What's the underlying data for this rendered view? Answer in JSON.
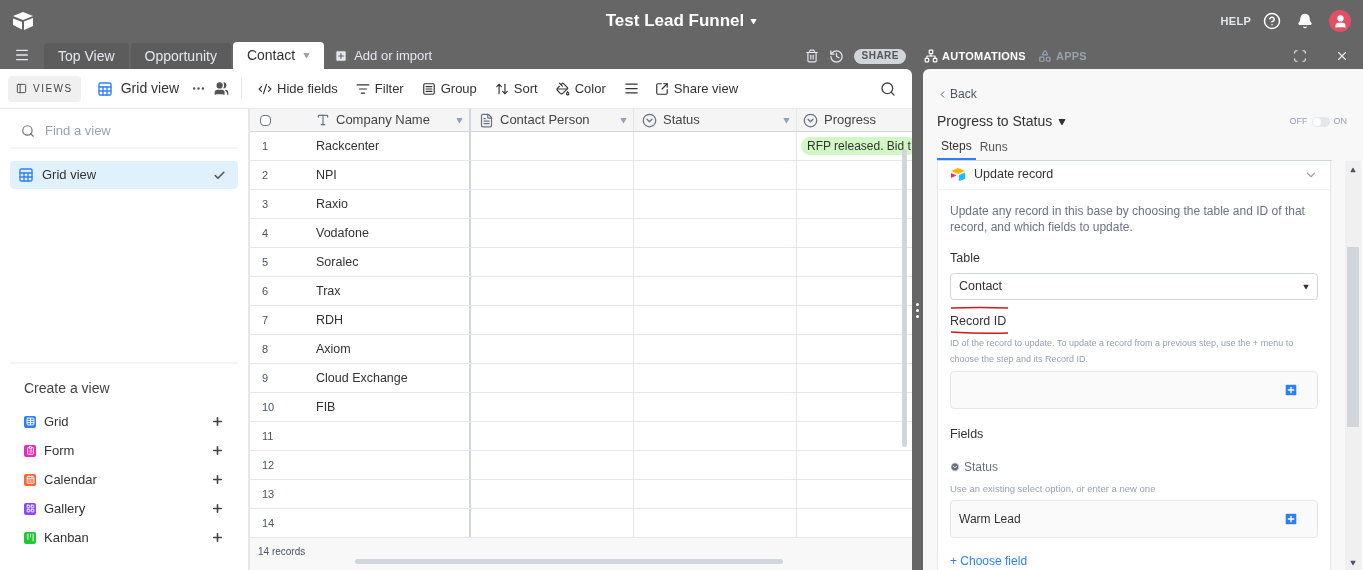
{
  "app_bar": {
    "title": "Test Lead Funnel",
    "help": "HELP"
  },
  "tabs": [
    {
      "label": "Top View",
      "selected": false
    },
    {
      "label": "Opportunity",
      "selected": false
    },
    {
      "label": "Contact",
      "selected": true
    }
  ],
  "add_table": "Add or import",
  "base_actions": {
    "share": "SHARE",
    "automations": "AUTOMATIONS",
    "apps": "APPS"
  },
  "toolbar": {
    "views_toggle": "VIEWS",
    "view_name": "Grid view",
    "actions": [
      {
        "kind": "hide",
        "label": "Hide fields"
      },
      {
        "kind": "filter",
        "label": "Filter"
      },
      {
        "kind": "group",
        "label": "Group"
      },
      {
        "kind": "sort",
        "label": "Sort"
      },
      {
        "kind": "color",
        "label": "Color"
      },
      {
        "kind": "row-height"
      },
      {
        "kind": "share",
        "label": "Share view"
      }
    ]
  },
  "sidebar": {
    "search": {
      "placeholder": "Find a view"
    },
    "views": [
      {
        "label": "Grid view",
        "selected": true
      }
    ],
    "create_heading": "Create a view",
    "create_items": [
      {
        "kind": "grid",
        "label": "Grid",
        "color": "#2d7ff9"
      },
      {
        "kind": "form",
        "label": "Form",
        "color": "#e929ba"
      },
      {
        "kind": "calendar",
        "label": "Calendar",
        "color": "#f7653b"
      },
      {
        "kind": "gallery",
        "label": "Gallery",
        "color": "#8b46ff"
      },
      {
        "kind": "kanban",
        "label": "Kanban",
        "color": "#20c933"
      }
    ]
  },
  "grid": {
    "select_all": {
      "checked": false
    },
    "columns": [
      {
        "kind": "text",
        "label": "Company Name"
      },
      {
        "kind": "long-text",
        "label": "Contact Person"
      },
      {
        "kind": "select",
        "label": "Status"
      },
      {
        "kind": "select",
        "label": "Progress"
      }
    ],
    "rows": [
      {
        "number": "1",
        "company": "Rackcenter",
        "progress": "RFP released. Bid t"
      },
      {
        "number": "2",
        "company": "NPI"
      },
      {
        "number": "3",
        "company": "Raxio"
      },
      {
        "number": "4",
        "company": "Vodafone"
      },
      {
        "number": "5",
        "company": "Soralec"
      },
      {
        "number": "6",
        "company": "Trax"
      },
      {
        "number": "7",
        "company": "RDH"
      },
      {
        "number": "8",
        "company": "Axiom"
      },
      {
        "number": "9",
        "company": "Cloud Exchange"
      },
      {
        "number": "10",
        "company": "FIB"
      },
      {
        "number": "11"
      },
      {
        "number": "12"
      },
      {
        "number": "13"
      },
      {
        "number": "14"
      }
    ],
    "footer": "14 records"
  },
  "panel": {
    "back": "Back",
    "automation_name": "Progress to Status",
    "toggle": {
      "off": "OFF",
      "on": "ON",
      "on_state": false
    },
    "tabs": [
      {
        "label": "Steps",
        "selected": true
      },
      {
        "label": "Runs",
        "selected": false
      }
    ],
    "step": {
      "title": "Update record",
      "expanded": true,
      "description": "Update any record in this base by choosing the table and ID of that record, and which fields to update.",
      "table_label": "Table",
      "table_value": "Contact",
      "record_label": "Record ID",
      "record_hint": "ID of the record to update. To update a record from a previous step, use the + menu to choose the step and its Record ID.",
      "fields_label": "Fields",
      "fields": [
        {
          "name": "Status",
          "hint": "Use an existing select option, or enter a new one",
          "value": "Warm Lead"
        }
      ],
      "choose_field": "+ Choose field"
    }
  }
}
